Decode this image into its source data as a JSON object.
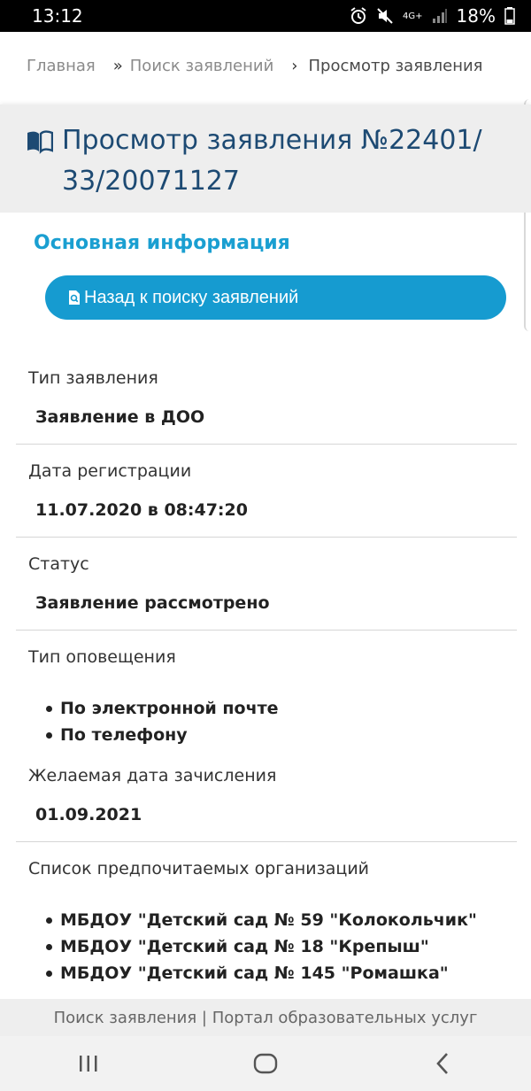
{
  "status_bar": {
    "time": "13:12",
    "battery": "18%",
    "network": "4G+"
  },
  "breadcrumb": {
    "items": [
      "Главная",
      "Поиск заявлений",
      "Просмотр заявления"
    ],
    "separator_icon": "chevron-right-icon"
  },
  "page": {
    "title": "Просмотр заявления №22401/ 33/20071127",
    "title_icon": "book-icon",
    "title_color": "#1d4a73"
  },
  "main": {
    "section_title": "Основная информация",
    "back_button_label": "Назад к поиску заявлений",
    "back_button_icon": "search-document-icon",
    "accent_color": "#169bd0",
    "fields": [
      {
        "label": "Тип заявления",
        "value": "Заявление в ДОО"
      },
      {
        "label": "Дата регистрации",
        "value": "11.07.2020 в 08:47:20"
      },
      {
        "label": "Статус",
        "value": "Заявление рассмотрено"
      },
      {
        "label": "Тип оповещения",
        "list": [
          "По электронной почте",
          "По телефону"
        ]
      },
      {
        "label": "Желаемая дата зачисления",
        "value": "01.09.2021"
      },
      {
        "label": "Список предпочитаемых организаций",
        "list": [
          "МБДОУ \"Детский сад № 59 \"Колокольчик\"",
          "МБДОУ \"Детский сад № 18 \"Крепыш\"",
          "МБДОУ \"Детский сад № 145 \"Ромашка\""
        ]
      }
    ]
  },
  "footer": {
    "text": "Поиск заявления | Портал образовательных услуг"
  },
  "nav_bar": {
    "buttons": [
      "recent-apps-icon",
      "home-icon",
      "back-icon"
    ]
  }
}
